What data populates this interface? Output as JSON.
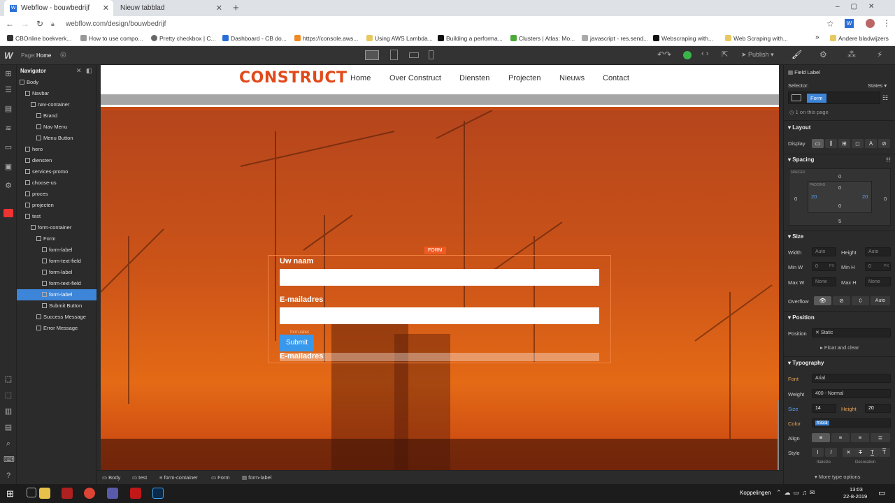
{
  "browser": {
    "tabs": [
      {
        "title": "Webflow - bouwbedrijf"
      },
      {
        "title": "Nieuw tabblad"
      }
    ],
    "new_tab_symbol": "+",
    "url": "webflow.com/design/bouwbedrijf",
    "bookmarks": [
      "CBOnline boekverk...",
      "How to use compo...",
      "Pretty checkbox | C...",
      "Dashboard - CB do...",
      "https://console.aws...",
      "Using AWS Lambda...",
      "Building a performa...",
      "Clusters | Atlas: Mo...",
      "javascript - res.send...",
      "Webscraping with...",
      "Web Scraping with...",
      "Andere bladwijzers"
    ],
    "more_bookmarks": "»"
  },
  "webflow_top": {
    "page_label": "Page:",
    "page_name": "Home",
    "publish_label": "Publish"
  },
  "navigator": {
    "title": "Navigator",
    "items": [
      {
        "label": "Body",
        "indent": 0
      },
      {
        "label": "Navbar",
        "indent": 1
      },
      {
        "label": "nav-container",
        "indent": 2
      },
      {
        "label": "Brand",
        "indent": 3
      },
      {
        "label": "Nav Menu",
        "indent": 3
      },
      {
        "label": "Menu Button",
        "indent": 3
      },
      {
        "label": "hero",
        "indent": 1
      },
      {
        "label": "diensten",
        "indent": 1
      },
      {
        "label": "services-promo",
        "indent": 1
      },
      {
        "label": "choose-us",
        "indent": 1
      },
      {
        "label": "proces",
        "indent": 1
      },
      {
        "label": "projecten",
        "indent": 1
      },
      {
        "label": "test",
        "indent": 1
      },
      {
        "label": "form-container",
        "indent": 2
      },
      {
        "label": "Form",
        "indent": 3
      },
      {
        "label": "form-label",
        "indent": 4
      },
      {
        "label": "form-text-field",
        "indent": 4
      },
      {
        "label": "form-label",
        "indent": 4
      },
      {
        "label": "form-text-field",
        "indent": 4
      },
      {
        "label": "form-label",
        "indent": 4,
        "selected": true
      },
      {
        "label": "Submit Button",
        "indent": 4
      },
      {
        "label": "Success Message",
        "indent": 3
      },
      {
        "label": "Error Message",
        "indent": 3
      }
    ]
  },
  "site": {
    "brand": "CONSTRUCT",
    "nav_links": [
      "Home",
      "Over Construct",
      "Diensten",
      "Projecten",
      "Nieuws",
      "Contact"
    ],
    "form_tag": "FORM",
    "label_name": "Uw naam",
    "label_email": "E-mailadres",
    "submit": "Submit",
    "ghost_label": "E-mailadres",
    "ghost_small": "form-label"
  },
  "breadcrumbs": [
    "Body",
    "test",
    "form-container",
    "Form",
    "form-label"
  ],
  "panel": {
    "element_type": "Field Label",
    "selector_label": "Selector:",
    "states_label": "States",
    "selector_value": "Form",
    "on_page": "1 on this page",
    "layout": "Layout",
    "display": "Display",
    "spacing": "Spacing",
    "margin_label": "MARGIN",
    "padding_label": "PADDING",
    "margin": {
      "top": "0",
      "right": "0",
      "bottom": "5",
      "left": "0"
    },
    "padding": {
      "top": "0",
      "right": "20",
      "bottom": "0",
      "left": "20"
    },
    "size": "Size",
    "width_label": "Width",
    "height_label": "Height",
    "width_value": "Auto",
    "height_value": "Auto",
    "minw_label": "Min W",
    "minh_label": "Min H",
    "minw_value": "0",
    "minh_value": "0",
    "maxw_label": "Max W",
    "maxh_label": "Max H",
    "maxw_value": "None",
    "maxh_value": "None",
    "px": "PX",
    "overflow_label": "Overflow",
    "overflow_auto": "Auto",
    "position": "Position",
    "position_label": "Position",
    "position_value": "Static",
    "float_clear": "Float and clear",
    "typography": "Typography",
    "font_label": "Font",
    "font_value": "Arial",
    "weight_label": "Weight",
    "weight_value": "400 - Normal",
    "size_label": "Size",
    "size_value": "14",
    "height_label2": "Height",
    "lineheight_value": "20",
    "color_label": "Color",
    "color_value": "#333",
    "align_label": "Align",
    "style_label": "Style",
    "italicize": "Italicize",
    "decoration": "Decoration",
    "more_type": "More type options"
  },
  "taskbar": {
    "language": "Koppelingen",
    "time": "13:03",
    "date": "22-8-2019"
  },
  "colors": {
    "accent": "#3d85d8",
    "brand": "#e04a1a",
    "submit": "#3898ec"
  }
}
